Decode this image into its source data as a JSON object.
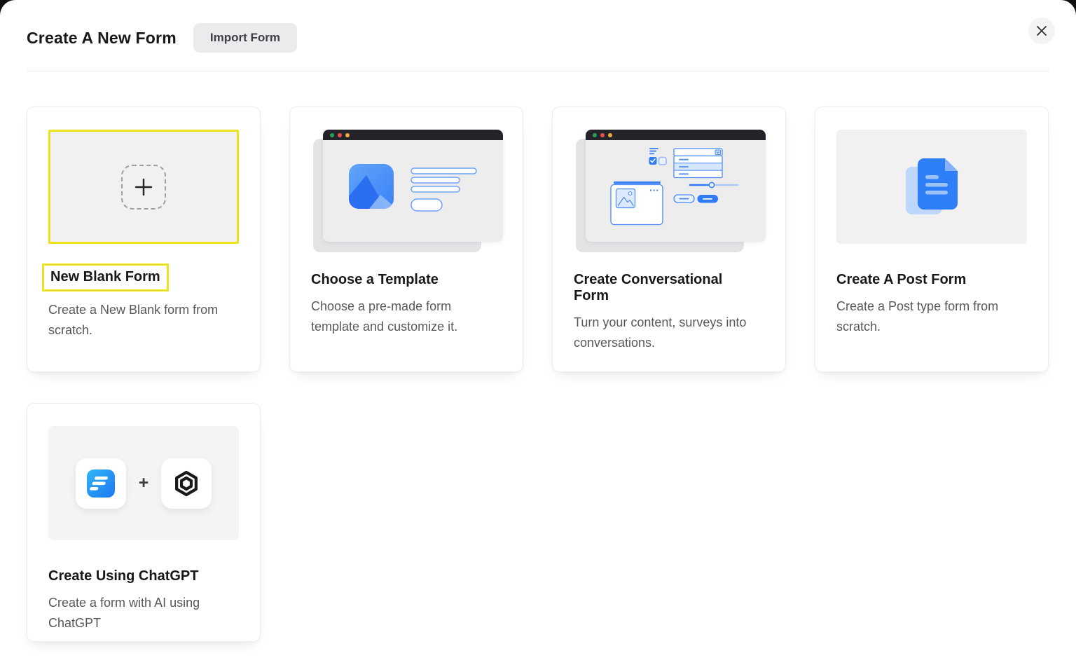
{
  "header": {
    "title": "Create A New Form",
    "import_button_label": "Import Form"
  },
  "cards": [
    {
      "title": "New Blank Form",
      "description": "Create a New Blank form from scratch.",
      "highlighted": true
    },
    {
      "title": "Choose a Template",
      "description": "Choose a pre-made form template and customize it."
    },
    {
      "title": "Create Conversational Form",
      "description": "Turn your content, surveys into conversations."
    },
    {
      "title": "Create A Post Form",
      "description": "Create a Post type form from scratch."
    },
    {
      "title": "Create Using ChatGPT",
      "description": "Create a form with AI using ChatGPT"
    }
  ],
  "icons": {
    "plus": "+"
  },
  "annotations": {
    "highlight_color": "#EDE31B",
    "highlighted_elements": [
      "new-blank-form-preview",
      "new-blank-form-title"
    ]
  },
  "colors": {
    "accent_blue": "#2F7CF6",
    "highlight_yellow": "#EDE31B"
  }
}
